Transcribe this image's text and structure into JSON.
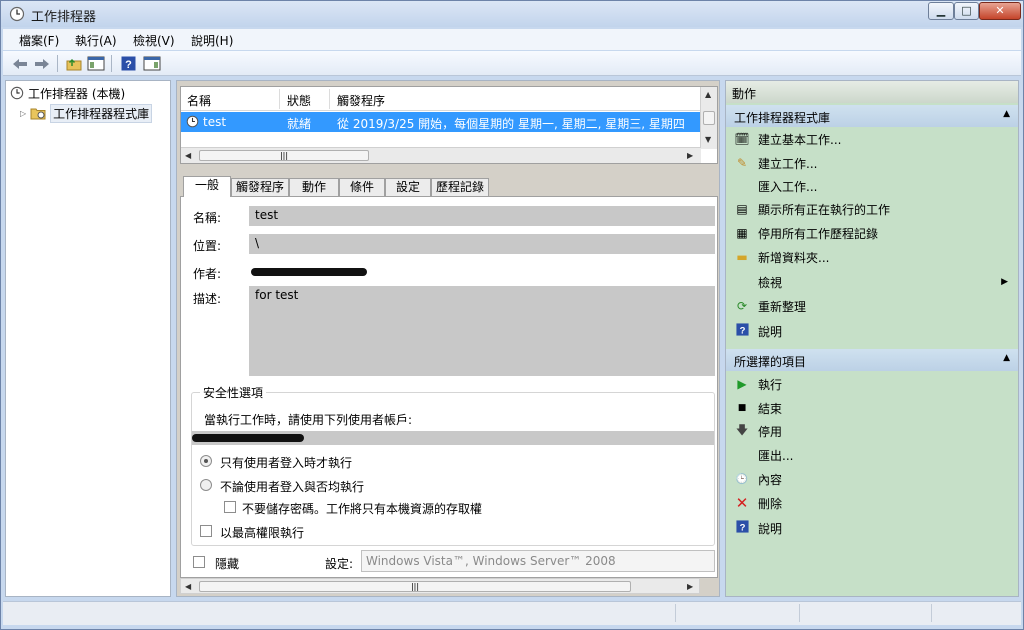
{
  "window": {
    "title": "工作排程器",
    "controls": {
      "minimize": "▁",
      "maximize": "□",
      "close": "✕"
    }
  },
  "menu": {
    "items": [
      "檔案(F)",
      "執行(A)",
      "檢視(V)",
      "說明(H)"
    ]
  },
  "toolbar": {
    "icons": [
      "back-arrow-icon",
      "forward-arrow-icon",
      "up-folder-icon",
      "show-hide-console-tree-icon",
      "help-icon",
      "show-hide-action-pane-icon"
    ]
  },
  "tree": {
    "root": "工作排程器 (本機)",
    "child": "工作排程器程式庫"
  },
  "tasklist": {
    "columns": [
      "名稱",
      "狀態",
      "觸發程序"
    ],
    "rows": [
      {
        "name": "test",
        "status": "就緒",
        "trigger": "從 2019/3/25 開始，每個星期的 星期一, 星期二, 星期三, 星期四"
      }
    ]
  },
  "tabs": [
    "一般",
    "觸發程序",
    "動作",
    "條件",
    "設定",
    "歷程記錄"
  ],
  "general": {
    "name_label": "名稱:",
    "name_value": "test",
    "location_label": "位置:",
    "location_value": "\\",
    "author_label": "作者:",
    "description_label": "描述:",
    "description_value": "for test",
    "security_legend": "安全性選項",
    "run_as_text": "當執行工作時，請使用下列使用者帳戶:",
    "radio_logged_on": "只有使用者登入時才執行",
    "radio_whether": "不論使用者登入與否均執行",
    "cb_no_password": "不要儲存密碼。工作將只有本機資源的存取權",
    "cb_highest": "以最高權限執行",
    "hidden_label": "隱藏",
    "configure_label": "設定:",
    "configure_value": "Windows Vista™, Windows Server™ 2008"
  },
  "actions": {
    "title": "動作",
    "sections": [
      {
        "title": "工作排程器程式庫",
        "items": [
          {
            "label": "建立基本工作...",
            "icon": "create-basic-task-icon"
          },
          {
            "label": "建立工作...",
            "icon": "create-task-icon"
          },
          {
            "label": "匯入工作...",
            "icon": ""
          },
          {
            "label": "顯示所有正在執行的工作",
            "icon": "running-tasks-icon"
          },
          {
            "label": "停用所有工作歷程記錄",
            "icon": "history-icon"
          },
          {
            "label": "新增資料夾...",
            "icon": "new-folder-icon"
          },
          {
            "label": "檢視",
            "icon": "",
            "submenu": "▶"
          },
          {
            "label": "重新整理",
            "icon": "refresh-icon"
          },
          {
            "label": "說明",
            "icon": "help-icon"
          }
        ]
      },
      {
        "title": "所選擇的項目",
        "items": [
          {
            "label": "執行",
            "icon": "run-icon"
          },
          {
            "label": "結束",
            "icon": "end-icon"
          },
          {
            "label": "停用",
            "icon": "disable-icon"
          },
          {
            "label": "匯出...",
            "icon": ""
          },
          {
            "label": "內容",
            "icon": "properties-icon"
          },
          {
            "label": "刪除",
            "icon": "delete-icon"
          },
          {
            "label": "說明",
            "icon": "help-icon"
          }
        ]
      }
    ]
  },
  "colors": {
    "selection": "#3399ff",
    "action_pane": "#c6e0c8",
    "section_header": "#c5d8ea",
    "window_frame": "#c7d8ee"
  }
}
